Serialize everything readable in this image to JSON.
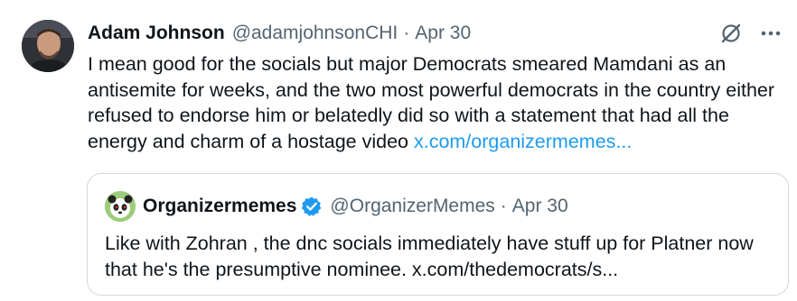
{
  "tweet": {
    "author_name": "Adam Johnson",
    "author_handle": "@adamjohnsonCHI",
    "separator": "·",
    "date": "Apr 30",
    "text": "I mean good for the socials but major Democrats smeared Mamdani as an antisemite for weeks, and the two most powerful democrats in the country either refused to endorse him or belatedly did so with a statement that had all the energy and charm of a hostage video ",
    "link_text": "x.com/organizermemes...",
    "icons": {
      "grok": "grok-icon",
      "more": "more-icon"
    }
  },
  "quote": {
    "author_name": "Organizermemes",
    "author_handle": "@OrganizerMemes",
    "separator": "·",
    "date": "Apr 30",
    "text": "Like with Zohran , the dnc socials immediately have stuff up for Platner now that he's the presumptive nominee. x.com/thedemocrats/s...",
    "verified_icon": "verified-badge-icon"
  },
  "colors": {
    "link": "#1d9bf0",
    "secondary_text": "#536471",
    "border": "#cfd9de",
    "verified": "#1d9bf0"
  }
}
